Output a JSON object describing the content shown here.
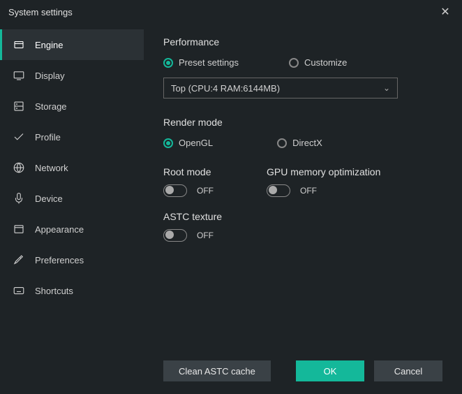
{
  "title": "System settings",
  "sidebar": {
    "items": [
      {
        "label": "Engine"
      },
      {
        "label": "Display"
      },
      {
        "label": "Storage"
      },
      {
        "label": "Profile"
      },
      {
        "label": "Network"
      },
      {
        "label": "Device"
      },
      {
        "label": "Appearance"
      },
      {
        "label": "Preferences"
      },
      {
        "label": "Shortcuts"
      }
    ]
  },
  "performance": {
    "title": "Performance",
    "preset_label": "Preset settings",
    "customize_label": "Customize",
    "dropdown_value": "Top (CPU:4 RAM:6144MB)"
  },
  "render": {
    "title": "Render mode",
    "opengl_label": "OpenGL",
    "directx_label": "DirectX"
  },
  "root": {
    "title": "Root mode",
    "state": "OFF"
  },
  "gpu": {
    "title": "GPU memory optimization",
    "state": "OFF"
  },
  "astc": {
    "title": "ASTC texture",
    "state": "OFF"
  },
  "footer": {
    "clean_label": "Clean ASTC cache",
    "ok_label": "OK",
    "cancel_label": "Cancel"
  }
}
